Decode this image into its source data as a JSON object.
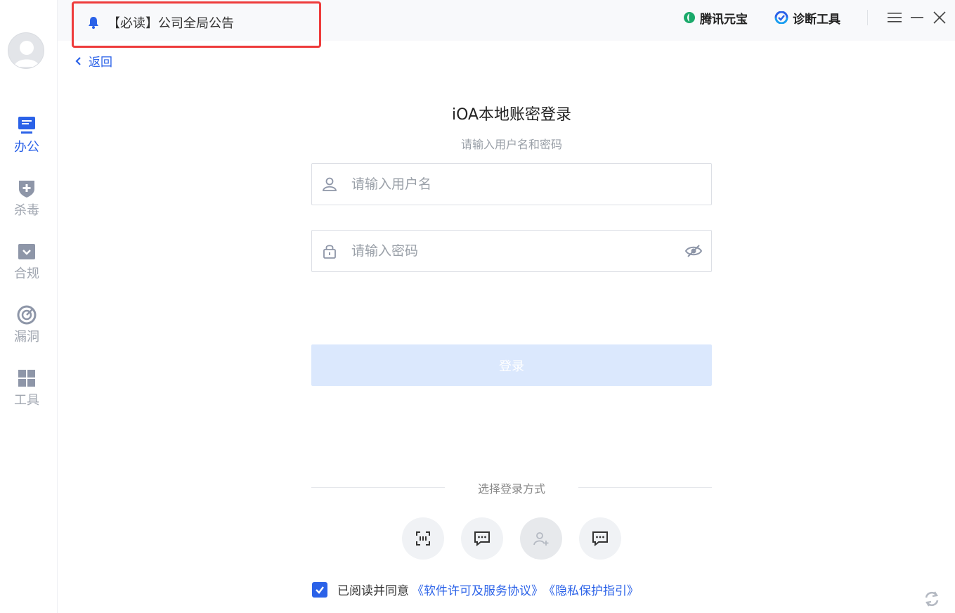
{
  "sidebar": {
    "items": [
      {
        "label": "办公",
        "icon": "monitor-icon",
        "active": true
      },
      {
        "label": "杀毒",
        "icon": "shield-plus-icon",
        "active": false
      },
      {
        "label": "合规",
        "icon": "check-box-icon",
        "active": false
      },
      {
        "label": "漏洞",
        "icon": "radar-icon",
        "active": false
      },
      {
        "label": "工具",
        "icon": "grid-icon",
        "active": false
      }
    ]
  },
  "topbar": {
    "notice": "【必读】公司全局公告",
    "yuanbao": "腾讯元宝",
    "diagnose": "诊断工具"
  },
  "back_label": "返回",
  "login": {
    "title": "iOA本地账密登录",
    "subtitle": "请输入用户名和密码",
    "username_placeholder": "请输入用户名",
    "password_placeholder": "请输入密码",
    "button_label": "登录",
    "methods_label": "选择登录方式"
  },
  "agreement": {
    "text": "已阅读并同意",
    "link1": "《软件许可及服务协议》",
    "link2": "《隐私保护指引》"
  },
  "colors": {
    "accent": "#2b62e8",
    "notice_border": "#ee3b3b",
    "button_disabled": "#dbe8fd"
  }
}
